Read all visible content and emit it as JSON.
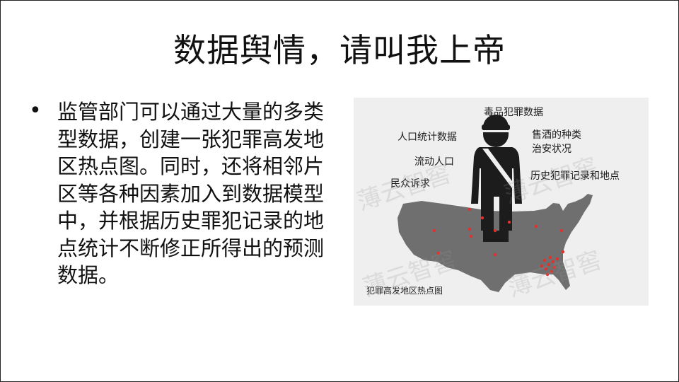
{
  "slide": {
    "title": "数据舆情，请叫我上帝",
    "bullet_text": "监管部门可以通过大量的多类型数据，创建一张犯罪高发地区热点图。同时，还将相邻片区等各种因素加入到数据模型中，并根据历史罪犯记录的地点统计不断修正所得出的预测数据。"
  },
  "figure": {
    "labels": {
      "drug_crime": "毒品犯罪数据",
      "population": "人口统计数据",
      "liquor": "售酒的种类",
      "security": "治安状况",
      "floating": "流动人口",
      "complaints": "民众诉求",
      "history": "历史犯罪记录和地点"
    },
    "caption": "犯罪高发地区热点图",
    "watermark": "薄云智窖",
    "colors": {
      "map": "#6f6f6f",
      "dot": "#e0312c",
      "officer": "#1c1c1c",
      "background": "#efefef"
    }
  }
}
